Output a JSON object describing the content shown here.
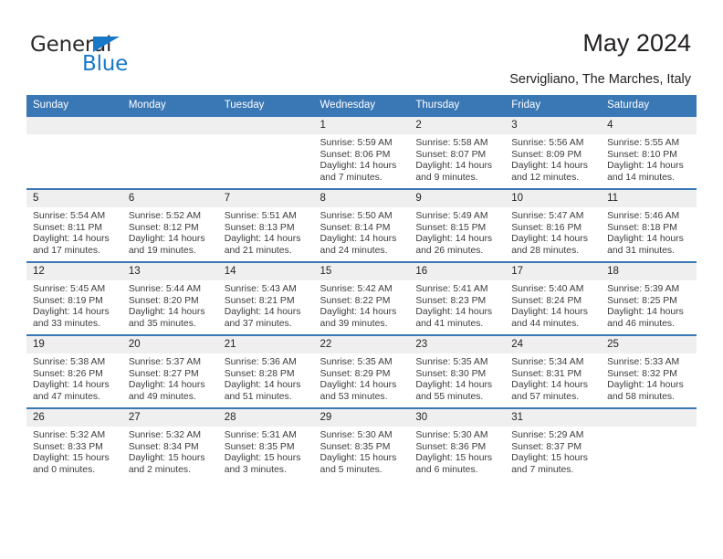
{
  "brand": {
    "name_part1": "General",
    "name_part2": "Blue",
    "accent_color": "#1878c8"
  },
  "header": {
    "title": "May 2024",
    "subtitle": "Servigliano, The Marches, Italy",
    "header_bg_color": "#3a77b5",
    "daynum_bg_color": "#efefef"
  },
  "weekdays": [
    "Sunday",
    "Monday",
    "Tuesday",
    "Wednesday",
    "Thursday",
    "Friday",
    "Saturday"
  ],
  "labels": {
    "sunrise_prefix": "Sunrise: ",
    "sunset_prefix": "Sunset: ",
    "daylight_prefix": "Daylight: "
  },
  "weeks": [
    [
      {
        "day": "",
        "empty": true
      },
      {
        "day": "",
        "empty": true
      },
      {
        "day": "",
        "empty": true
      },
      {
        "day": "1",
        "sunrise": "Sunrise: 5:59 AM",
        "sunset": "Sunset: 8:06 PM",
        "daylight": "Daylight: 14 hours and 7 minutes."
      },
      {
        "day": "2",
        "sunrise": "Sunrise: 5:58 AM",
        "sunset": "Sunset: 8:07 PM",
        "daylight": "Daylight: 14 hours and 9 minutes."
      },
      {
        "day": "3",
        "sunrise": "Sunrise: 5:56 AM",
        "sunset": "Sunset: 8:09 PM",
        "daylight": "Daylight: 14 hours and 12 minutes."
      },
      {
        "day": "4",
        "sunrise": "Sunrise: 5:55 AM",
        "sunset": "Sunset: 8:10 PM",
        "daylight": "Daylight: 14 hours and 14 minutes."
      }
    ],
    [
      {
        "day": "5",
        "sunrise": "Sunrise: 5:54 AM",
        "sunset": "Sunset: 8:11 PM",
        "daylight": "Daylight: 14 hours and 17 minutes."
      },
      {
        "day": "6",
        "sunrise": "Sunrise: 5:52 AM",
        "sunset": "Sunset: 8:12 PM",
        "daylight": "Daylight: 14 hours and 19 minutes."
      },
      {
        "day": "7",
        "sunrise": "Sunrise: 5:51 AM",
        "sunset": "Sunset: 8:13 PM",
        "daylight": "Daylight: 14 hours and 21 minutes."
      },
      {
        "day": "8",
        "sunrise": "Sunrise: 5:50 AM",
        "sunset": "Sunset: 8:14 PM",
        "daylight": "Daylight: 14 hours and 24 minutes."
      },
      {
        "day": "9",
        "sunrise": "Sunrise: 5:49 AM",
        "sunset": "Sunset: 8:15 PM",
        "daylight": "Daylight: 14 hours and 26 minutes."
      },
      {
        "day": "10",
        "sunrise": "Sunrise: 5:47 AM",
        "sunset": "Sunset: 8:16 PM",
        "daylight": "Daylight: 14 hours and 28 minutes."
      },
      {
        "day": "11",
        "sunrise": "Sunrise: 5:46 AM",
        "sunset": "Sunset: 8:18 PM",
        "daylight": "Daylight: 14 hours and 31 minutes."
      }
    ],
    [
      {
        "day": "12",
        "sunrise": "Sunrise: 5:45 AM",
        "sunset": "Sunset: 8:19 PM",
        "daylight": "Daylight: 14 hours and 33 minutes."
      },
      {
        "day": "13",
        "sunrise": "Sunrise: 5:44 AM",
        "sunset": "Sunset: 8:20 PM",
        "daylight": "Daylight: 14 hours and 35 minutes."
      },
      {
        "day": "14",
        "sunrise": "Sunrise: 5:43 AM",
        "sunset": "Sunset: 8:21 PM",
        "daylight": "Daylight: 14 hours and 37 minutes."
      },
      {
        "day": "15",
        "sunrise": "Sunrise: 5:42 AM",
        "sunset": "Sunset: 8:22 PM",
        "daylight": "Daylight: 14 hours and 39 minutes."
      },
      {
        "day": "16",
        "sunrise": "Sunrise: 5:41 AM",
        "sunset": "Sunset: 8:23 PM",
        "daylight": "Daylight: 14 hours and 41 minutes."
      },
      {
        "day": "17",
        "sunrise": "Sunrise: 5:40 AM",
        "sunset": "Sunset: 8:24 PM",
        "daylight": "Daylight: 14 hours and 44 minutes."
      },
      {
        "day": "18",
        "sunrise": "Sunrise: 5:39 AM",
        "sunset": "Sunset: 8:25 PM",
        "daylight": "Daylight: 14 hours and 46 minutes."
      }
    ],
    [
      {
        "day": "19",
        "sunrise": "Sunrise: 5:38 AM",
        "sunset": "Sunset: 8:26 PM",
        "daylight": "Daylight: 14 hours and 47 minutes."
      },
      {
        "day": "20",
        "sunrise": "Sunrise: 5:37 AM",
        "sunset": "Sunset: 8:27 PM",
        "daylight": "Daylight: 14 hours and 49 minutes."
      },
      {
        "day": "21",
        "sunrise": "Sunrise: 5:36 AM",
        "sunset": "Sunset: 8:28 PM",
        "daylight": "Daylight: 14 hours and 51 minutes."
      },
      {
        "day": "22",
        "sunrise": "Sunrise: 5:35 AM",
        "sunset": "Sunset: 8:29 PM",
        "daylight": "Daylight: 14 hours and 53 minutes."
      },
      {
        "day": "23",
        "sunrise": "Sunrise: 5:35 AM",
        "sunset": "Sunset: 8:30 PM",
        "daylight": "Daylight: 14 hours and 55 minutes."
      },
      {
        "day": "24",
        "sunrise": "Sunrise: 5:34 AM",
        "sunset": "Sunset: 8:31 PM",
        "daylight": "Daylight: 14 hours and 57 minutes."
      },
      {
        "day": "25",
        "sunrise": "Sunrise: 5:33 AM",
        "sunset": "Sunset: 8:32 PM",
        "daylight": "Daylight: 14 hours and 58 minutes."
      }
    ],
    [
      {
        "day": "26",
        "sunrise": "Sunrise: 5:32 AM",
        "sunset": "Sunset: 8:33 PM",
        "daylight": "Daylight: 15 hours and 0 minutes."
      },
      {
        "day": "27",
        "sunrise": "Sunrise: 5:32 AM",
        "sunset": "Sunset: 8:34 PM",
        "daylight": "Daylight: 15 hours and 2 minutes."
      },
      {
        "day": "28",
        "sunrise": "Sunrise: 5:31 AM",
        "sunset": "Sunset: 8:35 PM",
        "daylight": "Daylight: 15 hours and 3 minutes."
      },
      {
        "day": "29",
        "sunrise": "Sunrise: 5:30 AM",
        "sunset": "Sunset: 8:35 PM",
        "daylight": "Daylight: 15 hours and 5 minutes."
      },
      {
        "day": "30",
        "sunrise": "Sunrise: 5:30 AM",
        "sunset": "Sunset: 8:36 PM",
        "daylight": "Daylight: 15 hours and 6 minutes."
      },
      {
        "day": "31",
        "sunrise": "Sunrise: 5:29 AM",
        "sunset": "Sunset: 8:37 PM",
        "daylight": "Daylight: 15 hours and 7 minutes."
      },
      {
        "day": "",
        "empty": true
      }
    ]
  ]
}
